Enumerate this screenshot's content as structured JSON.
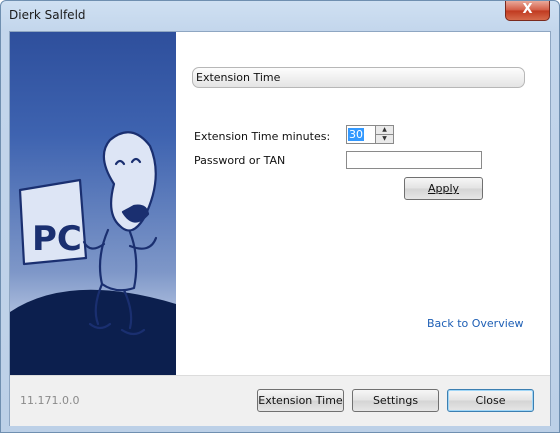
{
  "window": {
    "title": "Dierk Salfeld",
    "close_glyph": "X"
  },
  "sidebar": {
    "logo_text": "PC",
    "illustration": "pc-mascot-illustration",
    "colors": {
      "top": "#2e4f9c",
      "bottom": "#ccd8ee"
    }
  },
  "main": {
    "section_title": "Extension Time",
    "extension_minutes_label": "Extension Time minutes:",
    "extension_minutes_value": "30",
    "password_label": "Password or TAN",
    "password_value": "",
    "apply_label": "Apply",
    "back_link": "Back to Overview"
  },
  "footer": {
    "version": "11.171.0.0",
    "buttons": {
      "extension_time": "Extension Time",
      "settings": "Settings",
      "close": "Close"
    }
  }
}
